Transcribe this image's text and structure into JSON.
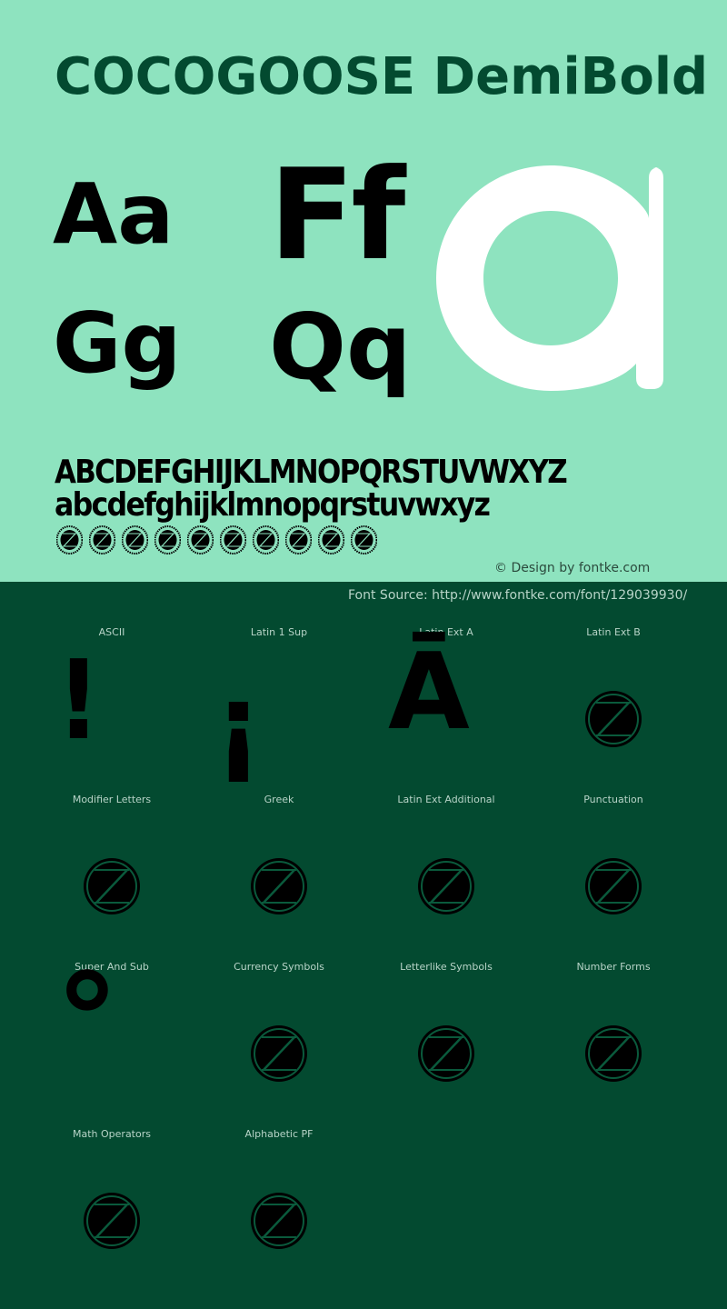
{
  "header": {
    "title": "COCOGOOSE DemiBold"
  },
  "samples": {
    "pairs": [
      "Aa",
      "Ff",
      "Gg",
      "Qq"
    ],
    "hero_glyph": "a",
    "uppercase": "ABCDEFGHIJKLMNOPQRSTUVWXYZ",
    "lowercase": "abcdefghijklmnopqrstuvwxyz",
    "digits_count": 10,
    "digits_icon": "notdef-placeholder-icon"
  },
  "credit": "© Design by fontke.com",
  "source": "Font Source: http://www.fontke.com/font/129039930/",
  "colors": {
    "top_bg": "#8ee3bf",
    "bottom_bg": "#034a30",
    "title": "#034a30",
    "hero_glyph": "#ffffff",
    "glyph": "#000000",
    "label": "#b8d4c8"
  },
  "blocks": [
    {
      "label": "ASCII",
      "glyph": "!"
    },
    {
      "label": "Latin 1 Sup",
      "glyph": "¡"
    },
    {
      "label": "Latin Ext A",
      "glyph": "Ā"
    },
    {
      "label": "Latin Ext B",
      "glyph": "notdef"
    },
    {
      "label": "Modifier Letters",
      "glyph": "notdef"
    },
    {
      "label": "Greek",
      "glyph": "notdef"
    },
    {
      "label": "Latin Ext Additional",
      "glyph": "notdef"
    },
    {
      "label": "Punctuation",
      "glyph": "notdef"
    },
    {
      "label": "Super And Sub",
      "glyph": "°"
    },
    {
      "label": "Currency Symbols",
      "glyph": "notdef"
    },
    {
      "label": "Letterlike Symbols",
      "glyph": "notdef"
    },
    {
      "label": "Number Forms",
      "glyph": "notdef"
    },
    {
      "label": "Math Operators",
      "glyph": "notdef"
    },
    {
      "label": "Alphabetic PF",
      "glyph": "notdef"
    }
  ]
}
